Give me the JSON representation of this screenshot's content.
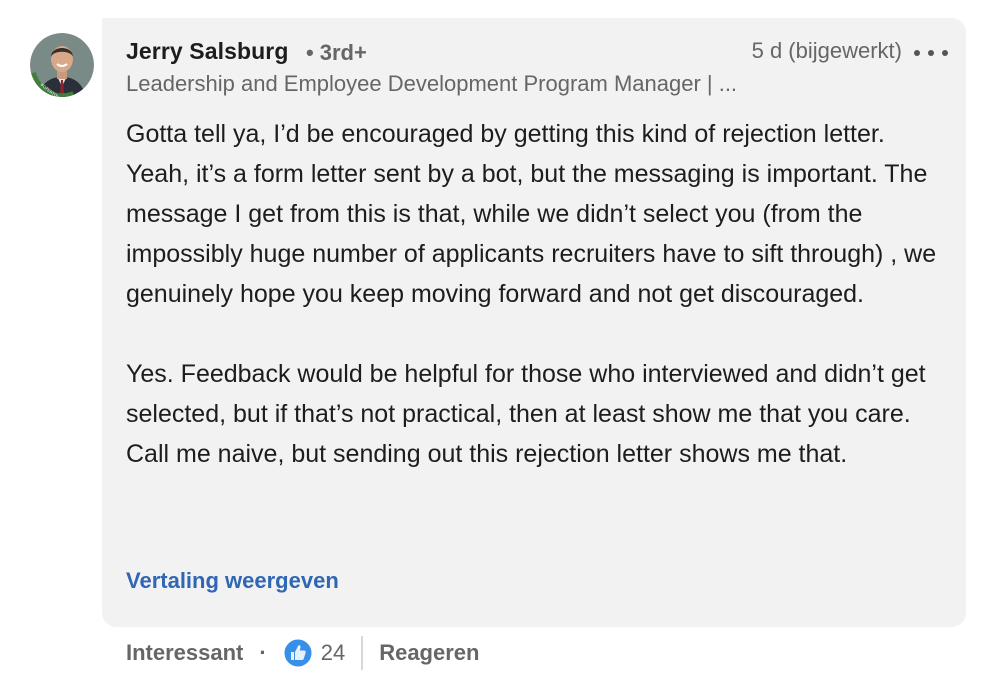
{
  "comment": {
    "author": "Jerry Salsburg",
    "degree": "3rd+",
    "degree_dot": "•",
    "time": "5 d (bijgewerkt)",
    "headline": "Leadership and Employee Development Program Manager | ...",
    "avatar_badge": "#OPENTOWORK",
    "paragraphs": [
      "Gotta tell ya, I’d be encouraged by getting this kind of rejection letter. Yeah, it’s a form letter sent by a bot, but the messaging is important. The message I get from this is that, while we didn’t select you (from the impossibly huge number of applicants recruiters have to sift through) , we genuinely hope you keep moving forward and not get discouraged.",
      "Yes. Feedback would be helpful for those who interviewed and didn’t get selected, but if that’s not practical, then at least show me that you care. Call me naive, but sending out this rejection letter shows me that."
    ],
    "translate_label": "Vertaling weergeven"
  },
  "actions": {
    "react_label": "Interessant",
    "separator": "·",
    "reaction_icon": "like-thumb-icon",
    "reaction_count": "24",
    "reply_label": "Reageren"
  },
  "colors": {
    "bubble_bg": "#f2f2f2",
    "link": "#2f67b5",
    "muted_text": "#666666",
    "badge_green": "#3f7f3a",
    "like_blue": "#378fe9"
  }
}
